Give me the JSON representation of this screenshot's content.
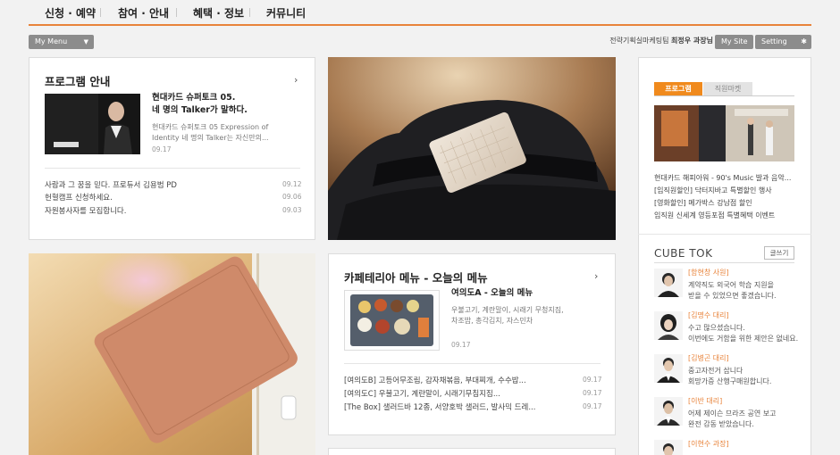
{
  "nav": [
    "신청 · 예약",
    "참여 · 안내",
    "혜택 · 정보",
    "커뮤니티"
  ],
  "util": {
    "my_menu": "My Menu",
    "user_prefix": "전략기획실마케팅팀",
    "user_name": "최정우 과장님",
    "my_site": "My Site",
    "setting": "Setting"
  },
  "program": {
    "title": "프로그램 안내",
    "feature_title_1": "현대카드 슈퍼토크 05.",
    "feature_title_2": "네 명의 Talker가 말하다.",
    "feature_desc_1": "현대카드 슈퍼토크 05 Expression of",
    "feature_desc_2": "Identity 네 명의 Talker는 자신만의...",
    "feature_date": "09.17",
    "items": [
      {
        "text": "사람과 그 꿈을 믿다. 프로듀서 김용범 PD",
        "date": "09.12"
      },
      {
        "text": "헌혈캠프 신청하세요.",
        "date": "09.06"
      },
      {
        "text": "자원봉사자를 모집합니다.",
        "date": "09.03"
      }
    ]
  },
  "cafeteria": {
    "title": "카페테리아 메뉴 - 오늘의 메뉴",
    "feature_title": "여의도A - 오늘의 메뉴",
    "feature_desc_1": "우불고기, 계란말이, 시래기 무청지짐,",
    "feature_desc_2": "차조밥, 총각김치, 자스민차",
    "feature_date": "09.17",
    "items": [
      {
        "text": "[여의도B] 고등어무조림, 감자채볶음, 부대찌개, 수수밥...",
        "date": "09.17"
      },
      {
        "text": "[여의도C] 우불고기, 계란말이, 시래기무침지짐...",
        "date": "09.17"
      },
      {
        "text": "[The Box] 샐러드바 12종, 서양호박 샐러드, 발사믹 드레...",
        "date": "09.17"
      }
    ]
  },
  "right": {
    "tab_active": "프로그램",
    "tab_inactive": "직원마켓",
    "links": [
      "현대카드 해피아워 - 90's Music 발과 음악...",
      "[임직원할인] 닥터지바고 특별할인 행사",
      "[영화할인] 메가박스 강남점 할인",
      "임직원 신세계 영등포점 특별혜택 이벤트"
    ],
    "tok_title": "CUBE TOK",
    "tok_write": "글쓰기",
    "tok": [
      {
        "name": "[함현창 사원]",
        "msg1": "계약직도 외국어 학습 지원을",
        "msg2": "받을 수 있었으면 좋겠습니다."
      },
      {
        "name": "[김명수 대리]",
        "msg1": "수고 많으셨습니다.",
        "msg2": "이번에도 거함을 위한 제안은 없네요."
      },
      {
        "name": "[김병곤 대리]",
        "msg1": "중고자전거 삽니다",
        "msg2": "회망가증 산행구매원합니다."
      },
      {
        "name": "[이반 대리]",
        "msg1": "어제 제이슨 므라즈 공연 보고",
        "msg2": "완전 감동 받았습니다."
      },
      {
        "name": "[이현수 과장]",
        "msg1": "",
        "msg2": ""
      }
    ]
  },
  "colors": {
    "accent": "#e8833a",
    "tab_active": "#f08a1d"
  }
}
